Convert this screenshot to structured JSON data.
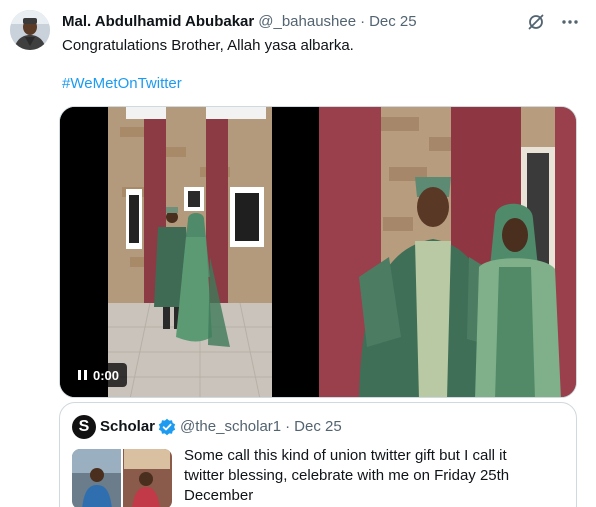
{
  "author": {
    "name": "Mal. Abdulhamid Abubakar",
    "handle": "@_bahaushee",
    "separator": "·",
    "date": "Dec 25"
  },
  "tweet": {
    "text": "Congratulations Brother, Allah yasa albarka.",
    "hashtag": "#WeMetOnTwitter"
  },
  "video": {
    "duration": "0:00",
    "icon": "pause-icon"
  },
  "header_icons": [
    "grok-icon",
    "more-icon"
  ],
  "quote": {
    "avatar_letter": "S",
    "name": "Scholar",
    "handle": "@the_scholar1",
    "separator": "·",
    "date": "Dec 25",
    "text": "Some call this kind of union twitter gift but I call it twitter blessing, celebrate with me on Friday 25th December"
  },
  "colors": {
    "link": "#1d9bf0",
    "muted": "#536471",
    "text": "#0f1419",
    "border": "#cfd9de",
    "outfit_green": "#4f8a6a"
  }
}
